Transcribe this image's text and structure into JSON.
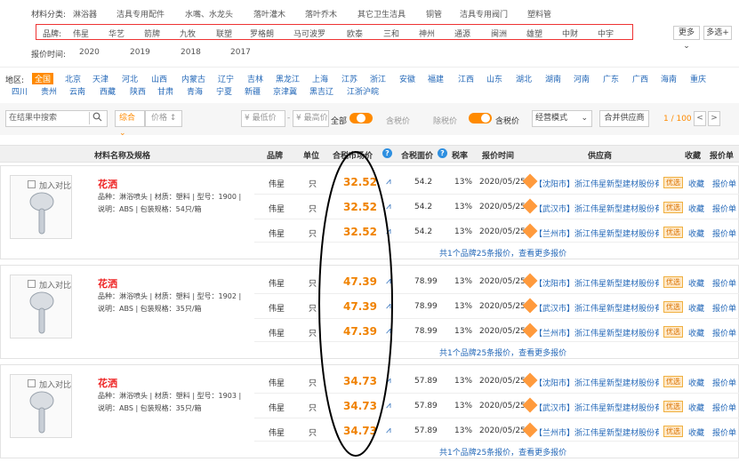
{
  "filters": {
    "category_label": "材料分类:",
    "categories": [
      "淋浴器",
      "洁具专用配件",
      "水嘴、水龙头",
      "落叶灌木",
      "落叶乔木",
      "其它卫生洁具",
      "铜管",
      "洁具专用阀门",
      "塑料管"
    ],
    "brand_label": "品牌:",
    "brands": [
      "伟星",
      "华艺",
      "箭牌",
      "九牧",
      "联塑",
      "罗格朗",
      "马可波罗",
      "欧泰",
      "三和",
      "神州",
      "通源",
      "闽洲",
      "雄塑",
      "中财",
      "中宇"
    ],
    "more_label": "更多",
    "multi_label": "多选+",
    "time_label": "报价时间:",
    "years": [
      "2020",
      "2019",
      "2018",
      "2017"
    ]
  },
  "region": {
    "label": "地区:",
    "row1": [
      "全国",
      "北京",
      "天津",
      "河北",
      "山西",
      "内蒙古",
      "辽宁",
      "吉林",
      "黑龙江",
      "上海",
      "江苏",
      "浙江",
      "安徽",
      "福建",
      "江西",
      "山东",
      "湖北",
      "湖南",
      "河南",
      "广东",
      "广西",
      "海南",
      "重庆"
    ],
    "row2": [
      "四川",
      "贵州",
      "云南",
      "西藏",
      "陕西",
      "甘肃",
      "青海",
      "宁夏",
      "新疆",
      "京津冀",
      "黑吉辽",
      "江浙沪皖"
    ]
  },
  "toolbar": {
    "search_placeholder": "在结果中搜索",
    "sort_composite": "综合",
    "sort_price": "价格",
    "min_price": "最低价",
    "max_price": "最高价",
    "all_label": "全部",
    "with_tax_label": "含税价",
    "without_tax_label": "除税价",
    "tax_price_label": "含税价",
    "mode_select": "经营模式",
    "merge_button": "合并供应商",
    "page_indicator": "1 / 100",
    "prev": "<",
    "next": ">"
  },
  "table_header": {
    "name": "材料名称及规格",
    "brand": "品牌",
    "unit": "单位",
    "market_price": "合税市场价",
    "face_price": "合税面价",
    "tax_rate": "税率",
    "quote_time": "报价时间",
    "supplier": "供应商",
    "favorite": "收藏",
    "quote_sheet": "报价单"
  },
  "products": [
    {
      "compare": "加入对比",
      "name": "花洒",
      "spec1": "品种：淋浴喷头 | 材质：塑料 | 型号：1900 |",
      "spec2": "说明：ABS | 包装规格：54只/箱",
      "more": "共1个品牌25条报价，查看更多报价",
      "rows": [
        {
          "brand": "伟星",
          "unit": "只",
          "price": "32.52",
          "face": "54.2",
          "rate": "13%",
          "date": "2020/05/25",
          "supplier": "【沈阳市】浙江伟星新型建材股份有限...",
          "tag": "优选",
          "fav": "收藏",
          "sheet": "报价单"
        },
        {
          "brand": "伟星",
          "unit": "只",
          "price": "32.52",
          "face": "54.2",
          "rate": "13%",
          "date": "2020/05/25",
          "supplier": "【武汉市】浙江伟星新型建材股份有限...",
          "tag": "优选",
          "fav": "收藏",
          "sheet": "报价单"
        },
        {
          "brand": "伟星",
          "unit": "只",
          "price": "32.52",
          "face": "54.2",
          "rate": "13%",
          "date": "2020/05/25",
          "supplier": "【兰州市】浙江伟星新型建材股份有限...",
          "tag": "优选",
          "fav": "收藏",
          "sheet": "报价单"
        }
      ]
    },
    {
      "compare": "加入对比",
      "name": "花洒",
      "spec1": "品种：淋浴喷头 | 材质：塑料 | 型号：1902 |",
      "spec2": "说明：ABS | 包装规格：35只/箱",
      "more": "共1个品牌25条报价，查看更多报价",
      "rows": [
        {
          "brand": "伟星",
          "unit": "只",
          "price": "47.39",
          "face": "78.99",
          "rate": "13%",
          "date": "2020/05/25",
          "supplier": "【沈阳市】浙江伟星新型建材股份有限...",
          "tag": "优选",
          "fav": "收藏",
          "sheet": "报价单"
        },
        {
          "brand": "伟星",
          "unit": "只",
          "price": "47.39",
          "face": "78.99",
          "rate": "13%",
          "date": "2020/05/25",
          "supplier": "【武汉市】浙江伟星新型建材股份有限...",
          "tag": "优选",
          "fav": "收藏",
          "sheet": "报价单"
        },
        {
          "brand": "伟星",
          "unit": "只",
          "price": "47.39",
          "face": "78.99",
          "rate": "13%",
          "date": "2020/05/25",
          "supplier": "【兰州市】浙江伟星新型建材股份有限...",
          "tag": "优选",
          "fav": "收藏",
          "sheet": "报价单"
        }
      ]
    },
    {
      "compare": "加入对比",
      "name": "花洒",
      "spec1": "品种：淋浴喷头 | 材质：塑料 | 型号：1903 |",
      "spec2": "说明：ABS | 包装规格：35只/箱",
      "more": "共1个品牌25条报价，查看更多报价",
      "rows": [
        {
          "brand": "伟星",
          "unit": "只",
          "price": "34.73",
          "face": "57.89",
          "rate": "13%",
          "date": "2020/05/25",
          "supplier": "【沈阳市】浙江伟星新型建材股份有限...",
          "tag": "优选",
          "fav": "收藏",
          "sheet": "报价单"
        },
        {
          "brand": "伟星",
          "unit": "只",
          "price": "34.73",
          "face": "57.89",
          "rate": "13%",
          "date": "2020/05/25",
          "supplier": "【武汉市】浙江伟星新型建材股份有限...",
          "tag": "优选",
          "fav": "收藏",
          "sheet": "报价单"
        },
        {
          "brand": "伟星",
          "unit": "只",
          "price": "34.73",
          "face": "57.89",
          "rate": "13%",
          "date": "2020/05/25",
          "supplier": "【兰州市】浙江伟星新型建材股份有限...",
          "tag": "优选",
          "fav": "收藏",
          "sheet": "报价单"
        }
      ]
    }
  ],
  "colors": {
    "accent": "#ff8a00",
    "link": "#2468b8",
    "price": "#f08200",
    "annotation": "#000000",
    "brand_box": "#e33333"
  }
}
